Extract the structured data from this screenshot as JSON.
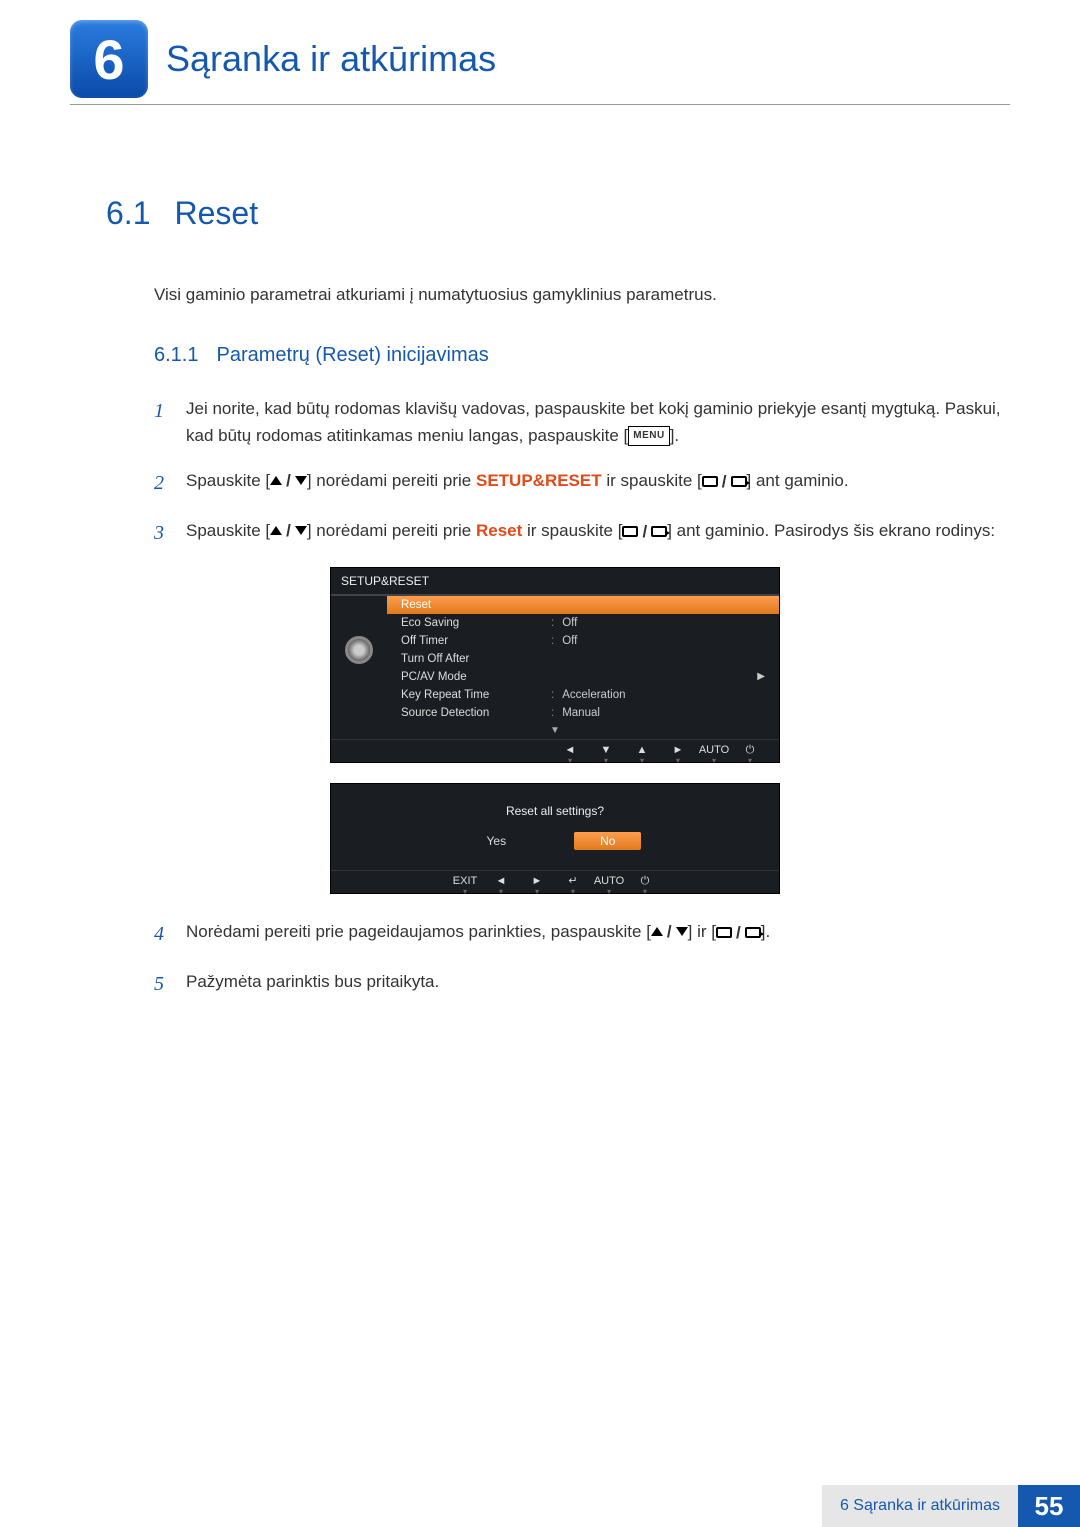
{
  "chapter": {
    "number": "6",
    "title": "Sąranka ir atkūrimas"
  },
  "section": {
    "number": "6.1",
    "title": "Reset"
  },
  "intro": "Visi gaminio parametrai atkuriami į numatytuosius gamyklinius parametrus.",
  "subsection": {
    "number": "6.1.1",
    "title": "Parametrų (Reset) inicijavimas"
  },
  "steps": {
    "s1": {
      "num": "1",
      "text": "Jei norite, kad būtų rodomas klavišų vadovas, paspauskite bet kokį gaminio priekyje esantį mygtuką. Paskui, kad būtų rodomas atitinkamas meniu langas, paspauskite [",
      "menu": "MENU",
      "after": "]."
    },
    "s2": {
      "num": "2",
      "pre": "Spauskite [",
      "mid": "] norėdami pereiti prie ",
      "kw": "SETUP&RESET",
      "post": " ir spauskite [",
      "end": "] ant gaminio."
    },
    "s3": {
      "num": "3",
      "pre": "Spauskite [",
      "mid": "] norėdami pereiti prie ",
      "kw": "Reset",
      "post": " ir spauskite [",
      "end": "] ant gaminio. Pasirodys šis ekrano rodinys:"
    },
    "s4": {
      "num": "4",
      "pre": "Norėdami pereiti prie pageidaujamos parinkties, paspauskite [",
      "mid": "] ir [",
      "end": "]."
    },
    "s5": {
      "num": "5",
      "text": "Pažymėta parinktis bus pritaikyta."
    }
  },
  "osd": {
    "title": "SETUP&RESET",
    "items": [
      {
        "label": "Reset",
        "value": "",
        "selected": true
      },
      {
        "label": "Eco Saving",
        "value": "Off"
      },
      {
        "label": "Off Timer",
        "value": "Off"
      },
      {
        "label": "Turn Off After",
        "value": ""
      },
      {
        "label": "PC/AV Mode",
        "value": "",
        "arrow": true
      },
      {
        "label": "Key Repeat Time",
        "value": "Acceleration"
      },
      {
        "label": "Source Detection",
        "value": "Manual"
      }
    ],
    "btns": [
      "◄",
      "▼",
      "▲",
      "►",
      "AUTO",
      "⏻"
    ],
    "confirm": "Reset all settings?",
    "yes": "Yes",
    "no": "No",
    "btns2": [
      "EXIT",
      "◄",
      "►",
      "↵",
      "AUTO",
      "⏻"
    ]
  },
  "footer": {
    "text": "6 Sąranka ir atkūrimas",
    "page": "55"
  }
}
